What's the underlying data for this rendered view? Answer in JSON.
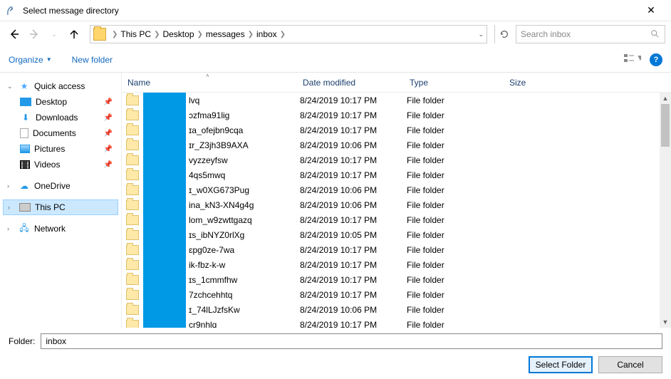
{
  "window": {
    "title": "Select message directory"
  },
  "breadcrumb": {
    "items": [
      "This PC",
      "Desktop",
      "messages",
      "inbox"
    ]
  },
  "search": {
    "placeholder": "Search inbox"
  },
  "toolbar": {
    "organize": "Organize",
    "newfolder": "New folder"
  },
  "sidebar": {
    "quick_access": "Quick access",
    "desktop": "Desktop",
    "downloads": "Downloads",
    "documents": "Documents",
    "pictures": "Pictures",
    "videos": "Videos",
    "onedrive": "OneDrive",
    "this_pc": "This PC",
    "network": "Network"
  },
  "columns": {
    "name": "Name",
    "date": "Date modified",
    "type": "Type",
    "size": "Size"
  },
  "rows": [
    {
      "suffix": "lvq",
      "date": "8/24/2019 10:17 PM",
      "type": "File folder"
    },
    {
      "suffix": "ɔzfma91lig",
      "date": "8/24/2019 10:17 PM",
      "type": "File folder"
    },
    {
      "suffix": "ɪa_ofejbn9cqa",
      "date": "8/24/2019 10:17 PM",
      "type": "File folder"
    },
    {
      "suffix": "ɪr_Z3jh3B9AXA",
      "date": "8/24/2019 10:06 PM",
      "type": "File folder"
    },
    {
      "suffix": "vyzzeyfsw",
      "date": "8/24/2019 10:17 PM",
      "type": "File folder"
    },
    {
      "suffix": "4qs5mwq",
      "date": "8/24/2019 10:17 PM",
      "type": "File folder"
    },
    {
      "suffix": "ɪ_w0XG673Pug",
      "date": "8/24/2019 10:06 PM",
      "type": "File folder"
    },
    {
      "suffix": "ina_kN3-XN4g4g",
      "date": "8/24/2019 10:06 PM",
      "type": "File folder"
    },
    {
      "suffix": "lom_w9zwttgazq",
      "date": "8/24/2019 10:17 PM",
      "type": "File folder"
    },
    {
      "suffix": "ɪs_ibNYZ0rlXg",
      "date": "8/24/2019 10:05 PM",
      "type": "File folder"
    },
    {
      "suffix": "ɛpg0ze-7wa",
      "date": "8/24/2019 10:17 PM",
      "type": "File folder"
    },
    {
      "suffix": "ik-fbz-k-w",
      "date": "8/24/2019 10:17 PM",
      "type": "File folder"
    },
    {
      "suffix": "ɪs_1cmmfhw",
      "date": "8/24/2019 10:17 PM",
      "type": "File folder"
    },
    {
      "suffix": "7zchcehhtq",
      "date": "8/24/2019 10:17 PM",
      "type": "File folder"
    },
    {
      "suffix": "ɪ_74lLJzfsKw",
      "date": "8/24/2019 10:06 PM",
      "type": "File folder"
    },
    {
      "suffix": "cr9nhlq",
      "date": "8/24/2019 10:17 PM",
      "type": "File folder"
    }
  ],
  "footer": {
    "label": "Folder:",
    "value": "inbox",
    "select": "Select Folder",
    "cancel": "Cancel"
  }
}
